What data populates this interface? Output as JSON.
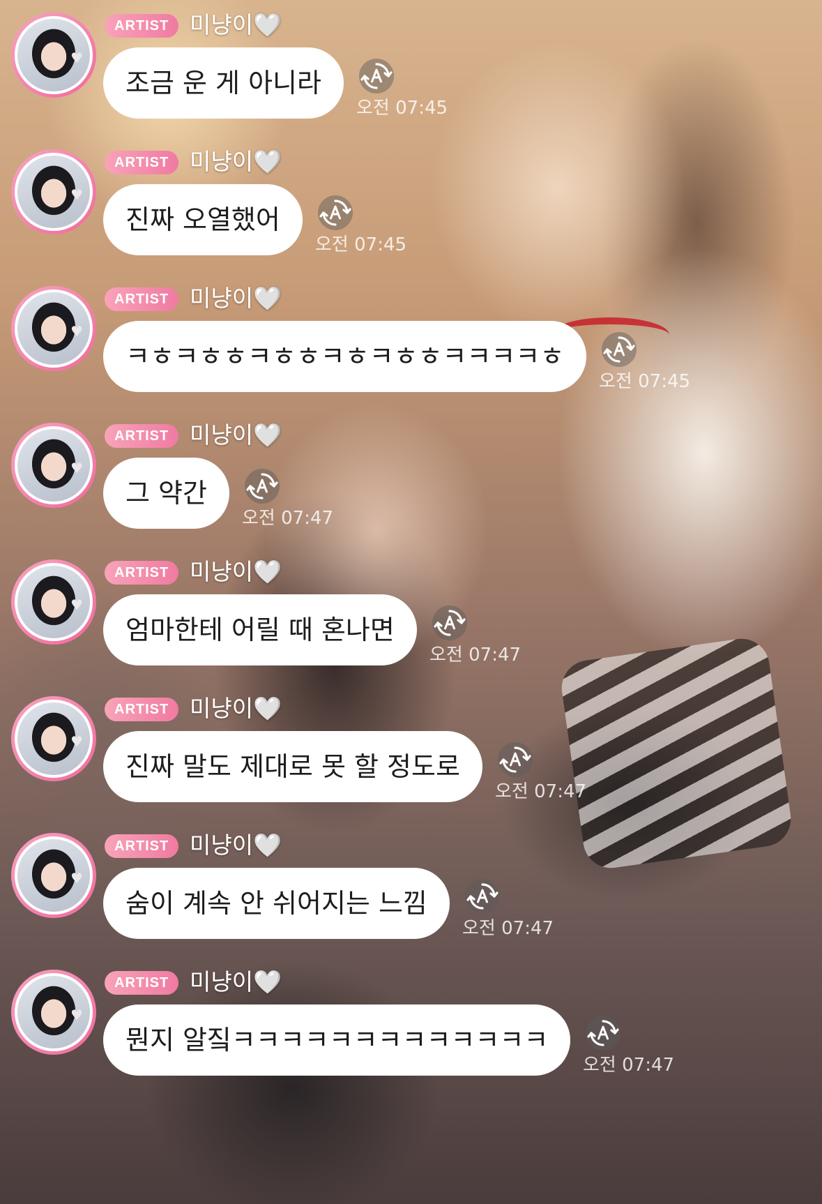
{
  "badge_label": "ARTIST",
  "sender_name": "미냥이🤍",
  "icons": {
    "avatar": "profile-photo",
    "heart": "white-heart-icon",
    "translate": "translate-icon"
  },
  "colors": {
    "badge": "#f07aa2",
    "bubble": "#ffffff",
    "avatar_ring": "#f06a9c"
  },
  "messages": [
    {
      "text": "조금 운 게 아니라",
      "time": "오전 07:45"
    },
    {
      "text": "진짜 오열했어",
      "time": "오전 07:45"
    },
    {
      "text": "ㅋㅎㅋㅎㅎㅋㅎㅎㅋㅎㅋㅎㅎㅋㅋㅋㅋㅎ",
      "time": "오전 07:45"
    },
    {
      "text": "그 약간",
      "time": "오전 07:47"
    },
    {
      "text": "엄마한테 어릴 때 혼나면",
      "time": "오전 07:47"
    },
    {
      "text": "진짜 말도 제대로 못 할 정도로",
      "time": "오전 07:47"
    },
    {
      "text": "숨이 계속 안 쉬어지는 느낌",
      "time": "오전 07:47"
    },
    {
      "text": "뭔지 알짘ㅋㅋㅋㅋㅋㅋㅋㅋㅋㅋㅋㅋㅋ",
      "time": "오전 07:47"
    }
  ]
}
